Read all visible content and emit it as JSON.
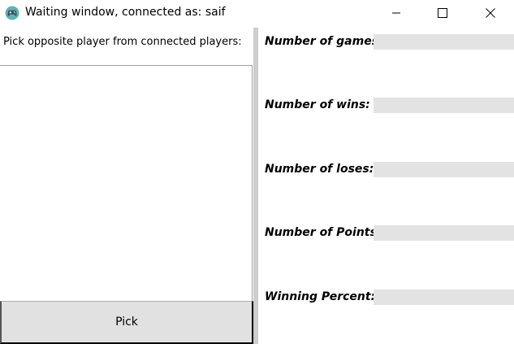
{
  "window": {
    "title": "Waiting window, connected as: saif"
  },
  "left": {
    "pick_label": "Pick opposite player from connected players:",
    "players": [],
    "pick_button_label": "Pick"
  },
  "stats": [
    {
      "label": "Number of games:",
      "value": ""
    },
    {
      "label": "Number of wins:",
      "value": ""
    },
    {
      "label": "Number of loses:",
      "value": ""
    },
    {
      "label": "Number of Points:",
      "value": ""
    },
    {
      "label": "Winning Percent:",
      "value": ""
    }
  ],
  "icons": {
    "app": "gamepad-icon",
    "minimize": "minimize-icon",
    "maximize": "maximize-icon",
    "close": "close-icon"
  }
}
